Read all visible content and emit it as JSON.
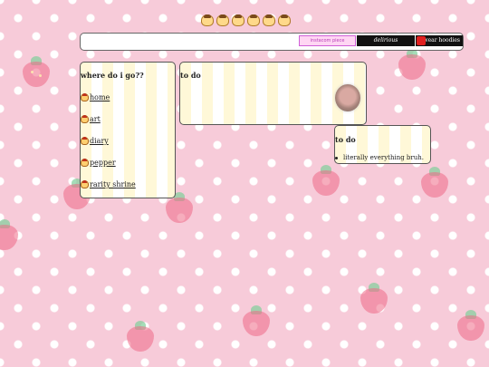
{
  "header": {
    "badges": {
      "search_text": "instacom piece",
      "delirious_text": "delirious",
      "hoodies_text": "I wear hoodies"
    }
  },
  "nav_panel": {
    "title": "where do i go??",
    "items": [
      {
        "label": "home"
      },
      {
        "label": "art"
      },
      {
        "label": "diary"
      },
      {
        "label": "pepper"
      },
      {
        "label": "rarity shrine"
      }
    ]
  },
  "todo_panel_top": {
    "title": "to do"
  },
  "todo_panel_bottom": {
    "title": "to do",
    "items": [
      "literally everything bruh."
    ]
  },
  "colors": {
    "background": "#f7cbd9",
    "stripe_yellow": "#fff8d8",
    "strawberry": "#ee6a86",
    "leaf": "#7fcf9a"
  }
}
